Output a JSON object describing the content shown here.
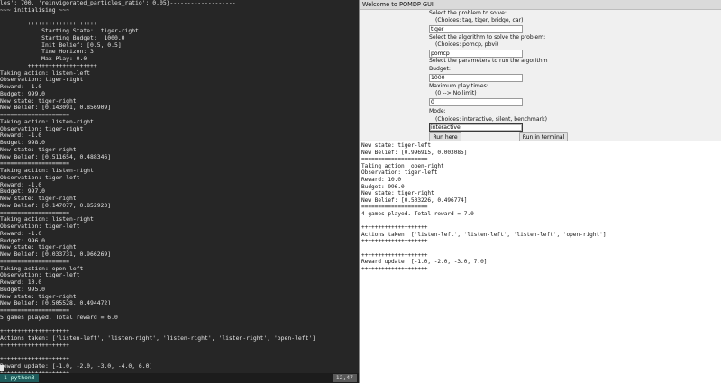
{
  "terminal": {
    "lines": [
      "les': 700, 'reinvigorated_particles_ratio': 0.05}-------------------",
      "~~~ initialising ~~~",
      "",
      "        ++++++++++++++++++++",
      "            Starting State:  tiger-right",
      "            Starting Budget:  1000.0",
      "            Init Belief: [0.5, 0.5]",
      "            Time Horizon: 3",
      "            Max Play: 0.0",
      "        ++++++++++++++++++++",
      "Taking action: listen-left",
      "Observation: tiger-right",
      "Reward: -1.0",
      "Budget: 999.0",
      "New state: tiger-right",
      "New Belief: [0.143091, 0.856909]",
      "====================",
      "Taking action: listen-right",
      "Observation: tiger-right",
      "Reward: -1.0",
      "Budget: 998.0",
      "New state: tiger-right",
      "New Belief: [0.511654, 0.488346]",
      "====================",
      "Taking action: listen-right",
      "Observation: tiger-left",
      "Reward: -1.0",
      "Budget: 997.0",
      "New state: tiger-right",
      "New Belief: [0.147077, 0.852923]",
      "====================",
      "Taking action: listen-right",
      "Observation: tiger-left",
      "Reward: -1.0",
      "Budget: 996.0",
      "New state: tiger-right",
      "New Belief: [0.033731, 0.966269]",
      "====================",
      "Taking action: open-left",
      "Observation: tiger-left",
      "Reward: 10.0",
      "Budget: 995.0",
      "New state: tiger-right",
      "New Belief: [0.505528, 0.494472]",
      "====================",
      "5 games played. Total reward = 6.0",
      "",
      "++++++++++++++++++++",
      "Actions taken: ['listen-left', 'listen-right', 'listen-right', 'listen-right', 'open-left']",
      "++++++++++++++++++++",
      "",
      "++++++++++++++++++++",
      "Reward update: [-1.0, -2.0, -3.0, -4.0, 6.0]",
      "++++++++++++++++++++"
    ],
    "status_window": "1 python3",
    "status_position": "12,47"
  },
  "gui": {
    "title": "Welcome to POMDP GUI",
    "problem_label": "Select the problem to solve:",
    "problem_choices": "(Choices: tag, tiger, bridge, car)",
    "problem_value": "tiger",
    "algorithm_label": "Select the algorithm to solve the problem:",
    "algorithm_choices": "(Choices: pomcp, pbvi)",
    "algorithm_value": "pomcp",
    "params_label": "Select the parameters to run the algorithm",
    "budget_label": "Budget:",
    "budget_value": "1000",
    "max_play_label": "Maximum play times:",
    "max_play_hint": "(0 --> No limit)",
    "max_play_value": "0",
    "mode_label": "Mode:",
    "mode_choices": "(Choices: interactive, silent, benchmark)",
    "mode_value": "interactive",
    "run_here_label": "Run here",
    "run_terminal_label": "Run in terminal",
    "output_lines": [
      "New state: tiger-left",
      "New Belief: [0.996915, 0.003085]",
      "====================",
      "Taking action: open-right",
      "Observation: tiger-left",
      "Reward: 10.0",
      "Budget: 996.0",
      "New state: tiger-right",
      "New Belief: [0.503226, 0.496774]",
      "====================",
      "4 games played. Total reward = 7.0",
      "",
      "++++++++++++++++++++",
      "Actions taken: ['listen-left', 'listen-left', 'listen-left', 'open-right']",
      "++++++++++++++++++++",
      "",
      "++++++++++++++++++++",
      "Reward update: [-1.0, -2.0, -3.0, 7.0]",
      "++++++++++++++++++++"
    ]
  }
}
